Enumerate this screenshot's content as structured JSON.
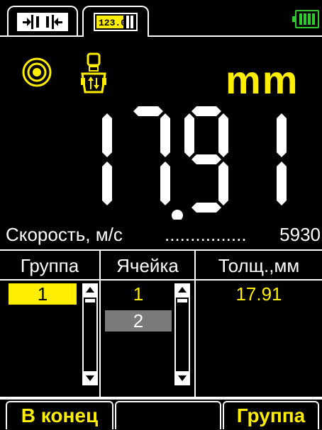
{
  "tabs": [
    {
      "name": "probe-mode-tab",
      "icon": "probe-gap-icon"
    },
    {
      "name": "digital-mode-tab",
      "icon": "digital-readout-icon"
    }
  ],
  "status": {
    "battery_icon": "battery-full-icon"
  },
  "display": {
    "mode_icon": "target-icon",
    "probe_icon": "probe-icon",
    "units": "mm",
    "reading": "17.91",
    "colors": {
      "accent": "#ffee00",
      "battery": "#2ecc2e",
      "selected_gray": "#7a7a7a"
    }
  },
  "speed": {
    "label": "Скорость, м/с",
    "dots": "................",
    "value": "5930"
  },
  "table": {
    "headers": {
      "group": "Группа",
      "cell": "Ячейка",
      "thickness": "Толщ.,мм"
    },
    "group_value": "1",
    "cells": [
      "1",
      "2"
    ],
    "thickness_value": "17.91"
  },
  "footer": {
    "left_label": "В конец",
    "middle_label": "",
    "right_label": "Группа"
  }
}
